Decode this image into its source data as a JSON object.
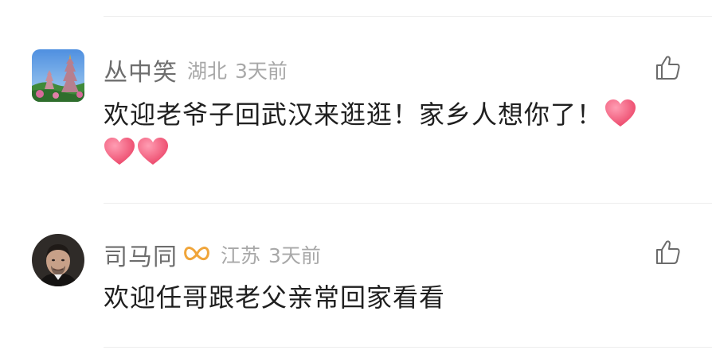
{
  "comments": [
    {
      "username": "丛中笑",
      "location": "湖北",
      "time": "3天前",
      "text": "欢迎老爷子回武汉来逛逛！家乡人想你了！",
      "avatar_icon": "pagoda-landscape-avatar",
      "trailing_emoji": [
        "heart",
        "heart",
        "heart"
      ]
    },
    {
      "username": "司马同",
      "badge_icon": "infinity-badge-icon",
      "location": "江苏",
      "time": "3天前",
      "text": "欢迎任哥跟老父亲常回家看看",
      "avatar_icon": "man-portrait-avatar"
    }
  ],
  "colors": {
    "username": "#6d6d6d",
    "meta": "#a8a8a8",
    "text": "#1f1f1f",
    "heart": "#ef4b6d",
    "badge": "#f0a53a",
    "divider": "#ededed"
  }
}
